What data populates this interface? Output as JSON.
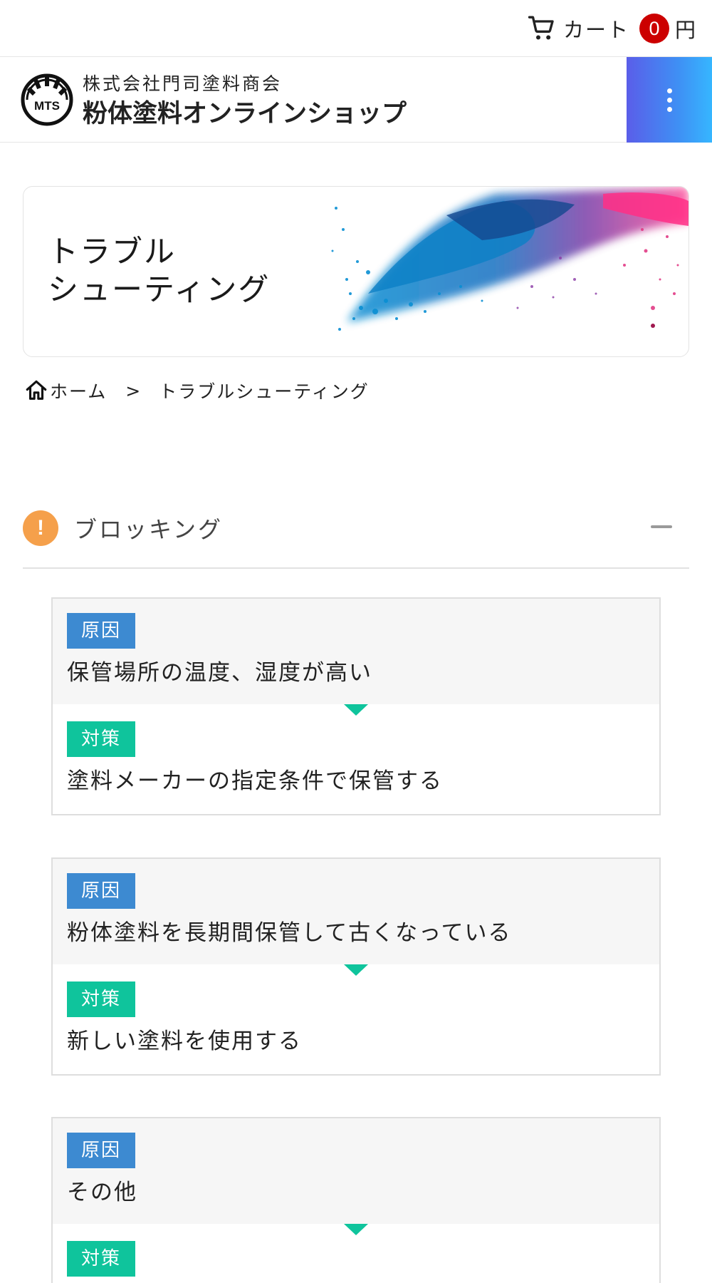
{
  "cart": {
    "label": "カート",
    "count": "0",
    "unit": "円"
  },
  "header": {
    "company": "株式会社門司塗料商会",
    "shop_name": "粉体塗料オンラインショップ",
    "logo_text": "MTS"
  },
  "hero": {
    "title_line1": "トラブル",
    "title_line2": "シューティング"
  },
  "breadcrumb": {
    "home": "ホーム",
    "separator": ">",
    "current": "トラブルシューティング"
  },
  "section": {
    "title": "ブロッキング",
    "icon_text": "!"
  },
  "labels": {
    "cause": "原因",
    "fix": "対策"
  },
  "items": [
    {
      "cause": "保管場所の温度、湿度が高い",
      "fix": "塗料メーカーの指定条件で保管する"
    },
    {
      "cause": "粉体塗料を長期間保管して古くなっている",
      "fix": "新しい塗料を使用する"
    },
    {
      "cause": "その他",
      "fix": ""
    }
  ],
  "colors": {
    "cause_tag": "#3d8ad1",
    "fix_tag": "#0fc49c",
    "badge": "#cc0000",
    "warning": "#f5a04b",
    "menu_gradient_start": "#5a5ee9",
    "menu_gradient_end": "#36b6ff"
  },
  "icons": {
    "cart": "cart-icon",
    "menu": "vertical-dots-icon",
    "home": "home-icon",
    "section": "exclamation-icon",
    "collapse": "minus-icon"
  }
}
